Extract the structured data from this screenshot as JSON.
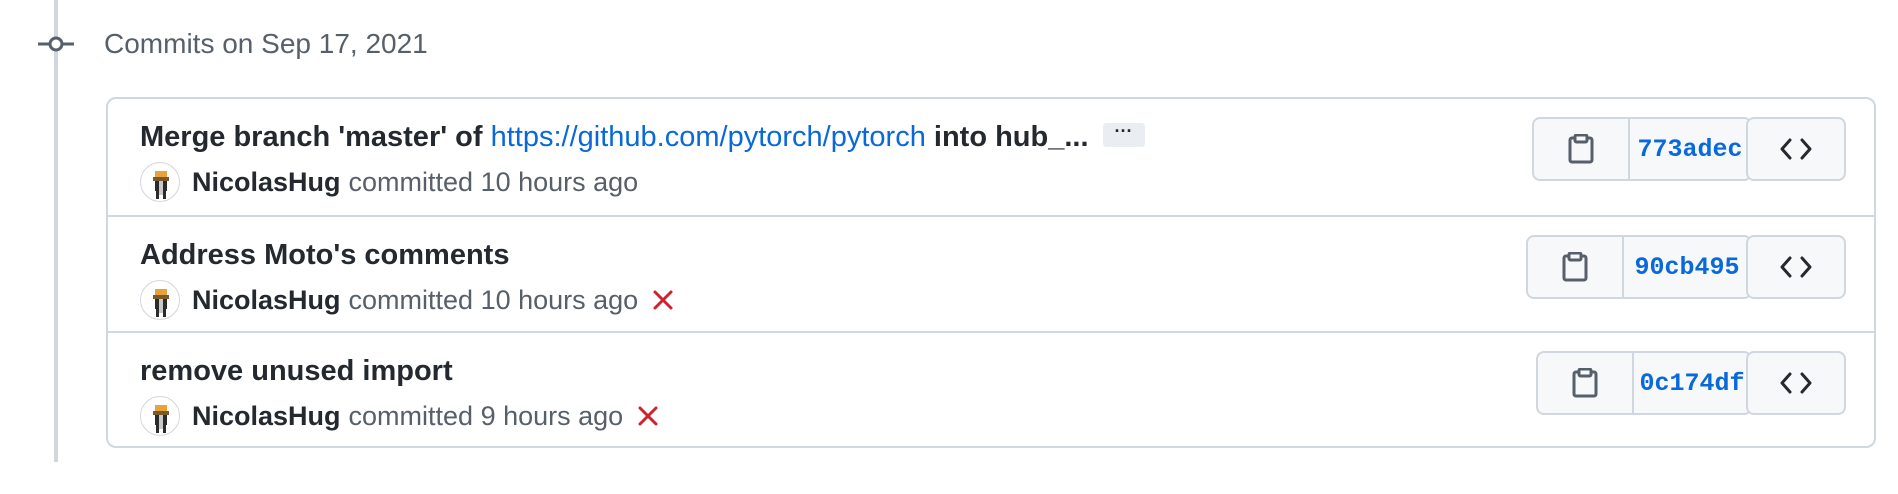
{
  "group": {
    "title": "Commits on Sep 17, 2021",
    "icon": "git-commit-icon"
  },
  "commits": [
    {
      "title_prefix": "Merge branch 'master' of ",
      "title_link": "https://github.com/pytorch/pytorch",
      "title_suffix": " into hub_...",
      "has_ellipsis": true,
      "ellipsis_label": "···",
      "author": "NicolasHug",
      "committed_text": "committed 10 hours ago",
      "status": "none",
      "sha": "773adec"
    },
    {
      "title": "Address Moto's comments",
      "author": "NicolasHug",
      "committed_text": "committed 10 hours ago",
      "status": "failure",
      "sha": "90cb495"
    },
    {
      "title": "remove unused import",
      "author": "NicolasHug",
      "committed_text": "committed 9 hours ago",
      "status": "failure",
      "sha": "0c174df"
    }
  ],
  "icons": {
    "copy": "clipboard-icon",
    "browse": "code-icon",
    "failure": "x-icon"
  },
  "colors": {
    "link": "#0969da",
    "failure": "#cf222e",
    "border": "#d0d7de",
    "muted": "#57606a"
  }
}
